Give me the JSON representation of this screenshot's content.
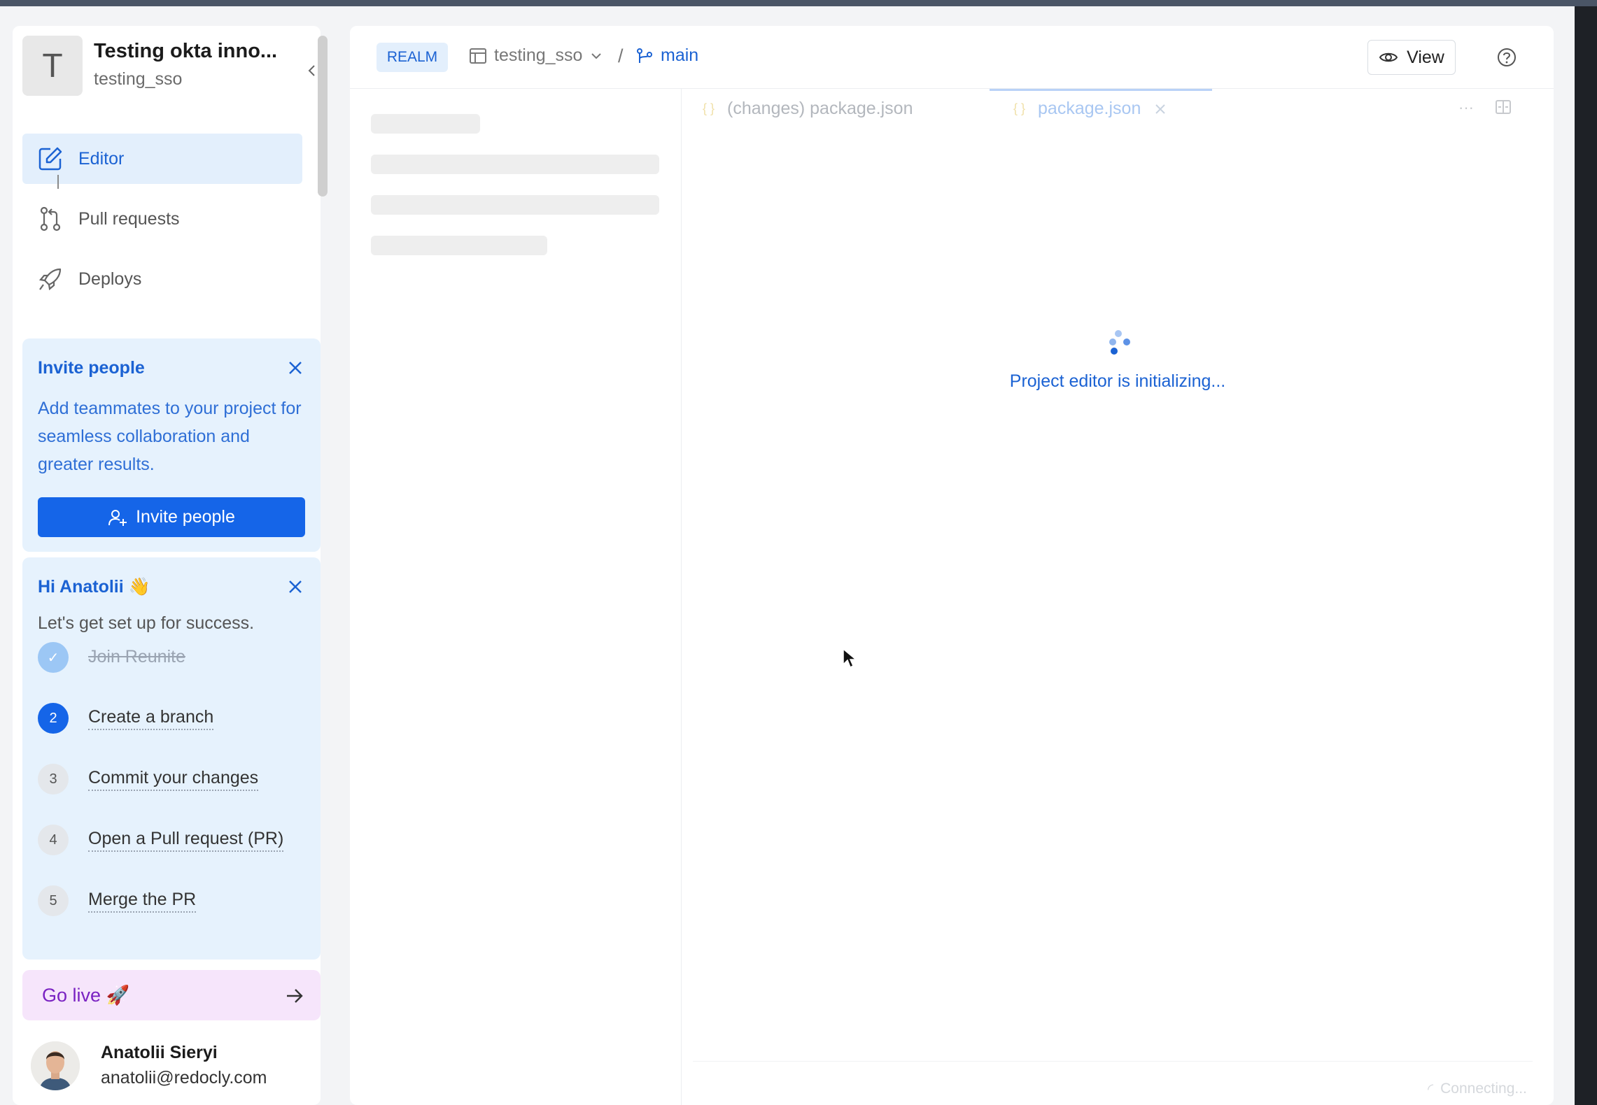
{
  "workspace": {
    "avatar_letter": "T",
    "name": "Testing okta inno...",
    "slug": "testing_sso"
  },
  "nav": {
    "items": [
      {
        "label": "Editor",
        "icon": "edit-icon",
        "active": true
      },
      {
        "label": "Pull requests",
        "icon": "pull-request-icon",
        "active": false
      },
      {
        "label": "Deploys",
        "icon": "rocket-icon",
        "active": false
      }
    ]
  },
  "invite": {
    "title": "Invite people",
    "text": "Add teammates to your project for seamless collaboration and greater results.",
    "button_label": "Invite people"
  },
  "onboarding": {
    "title": "Hi Anatolii 👋",
    "subtitle": "Let's get set up for success.",
    "steps": [
      {
        "num": "✓",
        "label": "Join Reunite",
        "status": "done"
      },
      {
        "num": "2",
        "label": "Create a branch",
        "status": "current"
      },
      {
        "num": "3",
        "label": "Commit your changes",
        "status": "todo"
      },
      {
        "num": "4",
        "label": "Open a Pull request (PR)",
        "status": "todo"
      },
      {
        "num": "5",
        "label": "Merge the PR",
        "status": "todo"
      }
    ]
  },
  "golive": {
    "label": "Go live 🚀"
  },
  "user": {
    "name": "Anatolii Sieryi",
    "email": "anatolii@redocly.com"
  },
  "header": {
    "badge": "REALM",
    "project": "testing_sso",
    "separator": "/",
    "branch": "main",
    "view_label": "View"
  },
  "tabs": [
    {
      "label": "(changes) package.json",
      "icon": "{ }"
    },
    {
      "label": "package.json",
      "icon": "{ }"
    }
  ],
  "tab_actions": {
    "more": "···"
  },
  "editor": {
    "loading_text": "Project editor is initializing..."
  },
  "status": {
    "text": "Connecting..."
  },
  "colors": {
    "accent": "#1565e8",
    "accent_text": "#1b62d3",
    "card_bg": "#e6f2fd",
    "golive_bg": "#f6e5fb"
  }
}
